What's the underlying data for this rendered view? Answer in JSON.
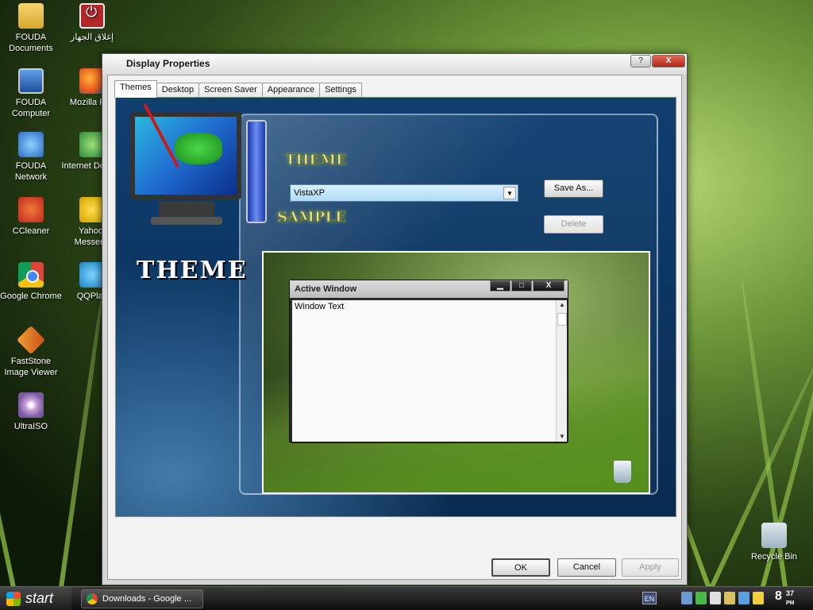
{
  "desktop": {
    "icons": [
      {
        "label": "FOUDA Documents",
        "icon": "folder-icon"
      },
      {
        "label": "إغلاق الجهاز",
        "icon": "power-icon"
      },
      {
        "label": "FOUDA Computer",
        "icon": "computer-icon"
      },
      {
        "label": "Mozilla Fire",
        "icon": "firefox-icon"
      },
      {
        "label": "FOUDA Network",
        "icon": "network-icon"
      },
      {
        "label": "Internet Downlo",
        "icon": "idm-icon"
      },
      {
        "label": "CCleaner",
        "icon": "ccleaner-icon"
      },
      {
        "label": "Yahoo! Messeng",
        "icon": "yahoo-icon"
      },
      {
        "label": "Google Chrome",
        "icon": "chrome-icon"
      },
      {
        "label": "QQPlay",
        "icon": "qqplayer-icon"
      },
      {
        "label": "FastStone Image Viewer",
        "icon": "faststone-icon"
      },
      {
        "label": "UltraISO",
        "icon": "ultraiso-icon"
      },
      {
        "label": "Recycle Bin",
        "icon": "recycle-bin-icon"
      }
    ]
  },
  "dialog": {
    "title": "Display Properties",
    "help_label": "?",
    "close_label": "X",
    "tabs": [
      {
        "label": "Themes",
        "active": true
      },
      {
        "label": "Desktop",
        "active": false
      },
      {
        "label": "Screen Saver",
        "active": false
      },
      {
        "label": "Appearance",
        "active": false
      },
      {
        "label": "Settings",
        "active": false
      }
    ],
    "themes": {
      "theme_heading": "THEME",
      "theme_label": "THEME",
      "sample_label": "SAMPLE",
      "selected_theme": "VistaXP",
      "save_as_label": "Save As...",
      "delete_label": "Delete",
      "preview": {
        "window_title": "Active Window",
        "window_text": "Window Text",
        "min": "▁",
        "max": "□",
        "close": "X"
      }
    },
    "buttons": {
      "ok": "OK",
      "cancel": "Cancel",
      "apply": "Apply"
    }
  },
  "taskbar": {
    "start_label": "start",
    "task_label": "Downloads - Google ...",
    "language": "EN",
    "clock_hour": "8",
    "clock_min": "37",
    "clock_ampm": "PM"
  }
}
